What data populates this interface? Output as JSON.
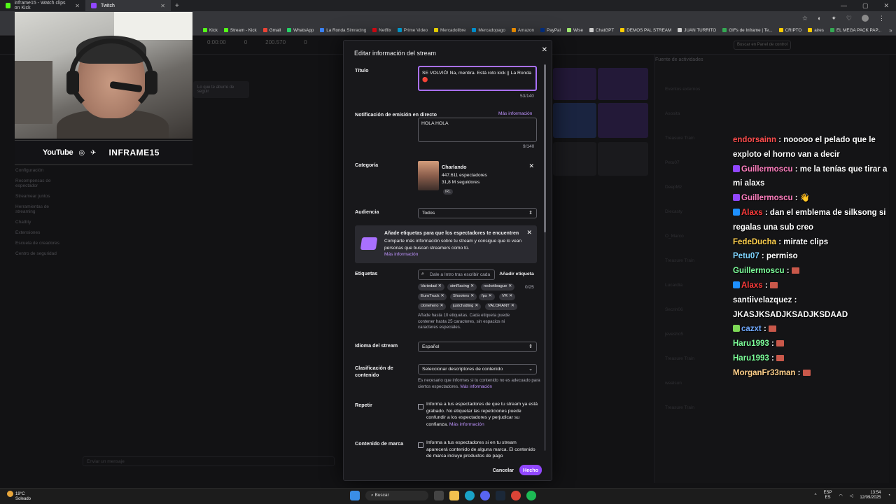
{
  "browser": {
    "tabs": [
      {
        "label": "inframe15 - Watch clips on Kick",
        "active": false,
        "favicon_color": "#53fc18"
      },
      {
        "label": "Twitch",
        "active": true,
        "favicon_color": "#9147ff"
      }
    ],
    "bookmarks": [
      {
        "label": "Kick",
        "color": "#53fc18"
      },
      {
        "label": "Stream - Kick",
        "color": "#53fc18"
      },
      {
        "label": "Gmail",
        "color": "#ea4335"
      },
      {
        "label": "WhatsApp",
        "color": "#25d366"
      },
      {
        "label": "La Ronda Simracing",
        "color": "#3b82f6"
      },
      {
        "label": "Netflix",
        "color": "#e50914"
      },
      {
        "label": "Prime Video",
        "color": "#00a8e1"
      },
      {
        "label": "Mercadolibre",
        "color": "#ffe600"
      },
      {
        "label": "Mercadopago",
        "color": "#009ee3"
      },
      {
        "label": "Amazon",
        "color": "#ff9900"
      },
      {
        "label": "PayPal",
        "color": "#003087"
      },
      {
        "label": "Wise",
        "color": "#9fe870"
      },
      {
        "label": "ChatGPT",
        "color": "#cccccc"
      },
      {
        "label": "DEMOS PAL STREAM",
        "color": "#ffcc00"
      },
      {
        "label": "JUAN TURRITO",
        "color": "#cccccc"
      },
      {
        "label": "GIFs de Inframe | Te...",
        "color": "#34a853"
      },
      {
        "label": "CRIPTO",
        "color": "#ffcc00"
      },
      {
        "label": "aires",
        "color": "#ffcc00"
      },
      {
        "label": "EL MEGA PACK PAP...",
        "color": "#34a853"
      }
    ]
  },
  "overlay": {
    "youtube_label": "YouTube",
    "channel_name": "INFRAME15"
  },
  "background": {
    "stats": [
      "0:00:00",
      "0",
      "200.570",
      "0"
    ],
    "search_placeholder": "Buscar en Panel de control",
    "sidebar": [
      "Configuración",
      "Recompensas de espectador",
      "Streamear juntos",
      "Herramientas de streaming",
      "Chatbty",
      "Extensiones",
      "Escuela de creadores",
      "Centro de seguridad"
    ],
    "panel_text": "Lo que te aburre de seguir",
    "feed_title": "Fuente de actividades",
    "feed_lines": [
      "Eventos externos",
      "Asosita",
      "Treasure Train",
      "Petu07",
      "DeepMz",
      "Diecasty",
      "O_Marco",
      "Treasure Train",
      "Lucardia",
      "Secrin06",
      "jevesho5",
      "Treasure Train",
      "wealsun",
      "Treasure Train"
    ],
    "chat_placeholder": "Enviar un mensaje"
  },
  "modal": {
    "title": "Editar información del stream",
    "title_label": "Título",
    "title_value": "SE VOLVIÓ! Na, mentira. Está roto kick || La Ronda 🔴",
    "title_counter": "53/140",
    "notif_label": "Notificación de emisión en directo",
    "notif_link": "Más información",
    "notif_value": "HOLA HOLA",
    "notif_counter": "9/140",
    "category_label": "Categoría",
    "category": {
      "name": "Charlando",
      "viewers": "447.611 espectadores",
      "followers": "31,8 M seguidores",
      "tag": "IRL"
    },
    "audience_label": "Audiencia",
    "audience_value": "Todos",
    "promo": {
      "title": "Añade etiquetas para que los espectadores te encuentren",
      "body": "Comparte más información sobre tu stream y consigue que lo vean personas que buscan streamers como tú.",
      "link": "Más información"
    },
    "tags_label": "Etiquetas",
    "tags_placeholder": "Dale a Intro tras escribir cada",
    "tags_add": "Añadir etiqueta",
    "tags_count": "0/25",
    "tags": [
      "Variedad",
      "simRacing",
      "rocketleague",
      "EuroTruck",
      "Shooters",
      "fps",
      "VR",
      "clonehero",
      "justchatting",
      "VALORANT"
    ],
    "tags_note": "Añade hasta 10 etiquetas. Cada etiqueta puede contener hasta 25 caracteres, sin espacios ni caracteres especiales.",
    "language_label": "Idioma del stream",
    "language_value": "Español",
    "classification_label": "Clasificación de contenido",
    "classification_value": "Seleccionar descriptores de contenido",
    "classification_note": "Es necesario que informes si tu contenido no es adecuado para ciertos espectadores.",
    "classification_link": "Más información",
    "repeat_label": "Repetir",
    "repeat_text": "Informa a tus espectadores de que tu stream ya está grabado. No etiquetar las repeticiones puede confundir a los espectadores y perjudicar su confianza.",
    "repeat_link": "Más información",
    "brand_label": "Contenido de marca",
    "brand_text": "Informa a tus espectadores si en tu stream aparecerá contenido de alguna marca. El contenido de marca incluye productos de pago",
    "cancel_label": "Cancelar",
    "done_label": "Hecho"
  },
  "chat": [
    {
      "user": "endorsainn",
      "color": "#ff4d4d",
      "badge": "",
      "text": ": nooooo el pelado que le exploto el horno van a decir"
    },
    {
      "user": "Guillermoscu",
      "color": "#ff7fbf",
      "badge": "#9147ff",
      "text": ": me la tenías que tirar a mi alaxs"
    },
    {
      "user": "Guillermoscu",
      "color": "#ff7fbf",
      "badge": "#9147ff",
      "text": ": 👋"
    },
    {
      "user": "Alaxs",
      "color": "#ff3b3b",
      "badge": "#1e90ff",
      "text": ": dan el emblema de silksong si regalas una sub creo"
    },
    {
      "user": "FedeDucha",
      "color": "#ffd04d",
      "badge": "",
      "text": ": mirate clips"
    },
    {
      "user": "Petu07",
      "color": "#7fd4ff",
      "badge": "",
      "text": ": permiso"
    },
    {
      "user": "Guillermoscu",
      "color": "#7dff9a",
      "badge": "",
      "text": ": ",
      "emote": true
    },
    {
      "user": "Alaxs",
      "color": "#ff3b3b",
      "badge": "#1e90ff",
      "text": ": ",
      "emote": true
    },
    {
      "user": "santiivelazquez",
      "color": "#ffffff",
      "badge": "",
      "text": ": JKASJKSADJKSADJKSDAAD"
    },
    {
      "user": "cazxt",
      "color": "#6fa8ff",
      "badge": "#7ed957",
      "text": ": ",
      "emote": true
    },
    {
      "user": "Haru1993",
      "color": "#7dff9a",
      "badge": "",
      "text": ": ",
      "emote": true
    },
    {
      "user": "Haru1993",
      "color": "#7dff9a",
      "badge": "",
      "text": ": ",
      "emote": true
    },
    {
      "user": "MorganFr33man",
      "color": "#ffd08a",
      "badge": "",
      "text": ": ",
      "emote": true
    }
  ],
  "taskbar": {
    "temp": "19°C",
    "weather": "Soleado",
    "search": "Buscar",
    "lang_top": "ESP",
    "lang_bottom": "ES",
    "time": "13:54",
    "date": "12/09/2025"
  }
}
